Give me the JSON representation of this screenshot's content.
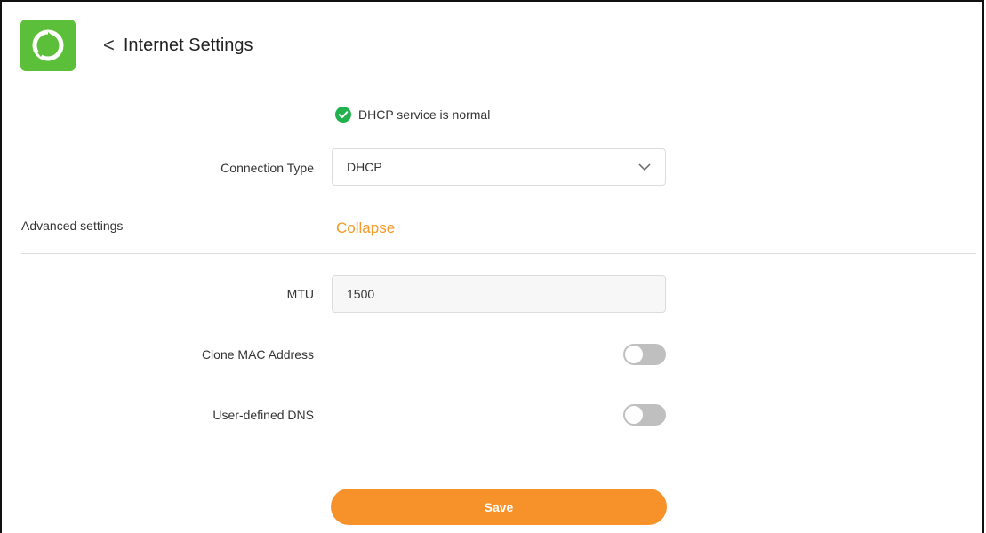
{
  "header": {
    "back_symbol": "<",
    "title": "Internet Settings",
    "logo_icon": "router-app-icon",
    "logo_color": "#5cbf3a"
  },
  "status": {
    "icon": "check-circle-icon",
    "icon_color": "#22b14c",
    "text": "DHCP service is normal"
  },
  "connection_type": {
    "label": "Connection Type",
    "selected": "DHCP"
  },
  "advanced": {
    "label": "Advanced settings",
    "toggle_link": "Collapse",
    "link_color": "#f39a2b"
  },
  "mtu": {
    "label": "MTU",
    "value": "1500"
  },
  "clone_mac": {
    "label": "Clone MAC Address",
    "enabled": false
  },
  "custom_dns": {
    "label": "User-defined DNS",
    "enabled": false
  },
  "actions": {
    "save_label": "Save",
    "save_color": "#f7922a"
  }
}
